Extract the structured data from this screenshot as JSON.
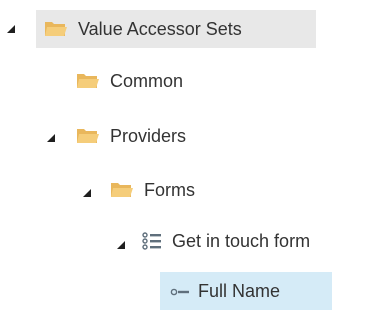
{
  "tree": {
    "root": {
      "label": "Value Accessor Sets",
      "icon": "folder-icon",
      "expanded": true
    },
    "common": {
      "label": "Common",
      "icon": "folder-icon"
    },
    "providers": {
      "label": "Providers",
      "icon": "folder-icon",
      "expanded": true
    },
    "forms": {
      "label": "Forms",
      "icon": "folder-icon",
      "expanded": true
    },
    "form": {
      "label": "Get in touch form",
      "icon": "list-icon",
      "expanded": true
    },
    "field": {
      "label": "Full Name",
      "icon": "field-icon",
      "selected": true
    }
  },
  "colors": {
    "folder": "#f5cd7a",
    "folder_dark": "#e9b75c",
    "icon_gray": "#5f6f7c",
    "arrow": "#1f1f1f",
    "root_highlight": "#e8e8e8",
    "selected_highlight": "#d5ebf7"
  }
}
